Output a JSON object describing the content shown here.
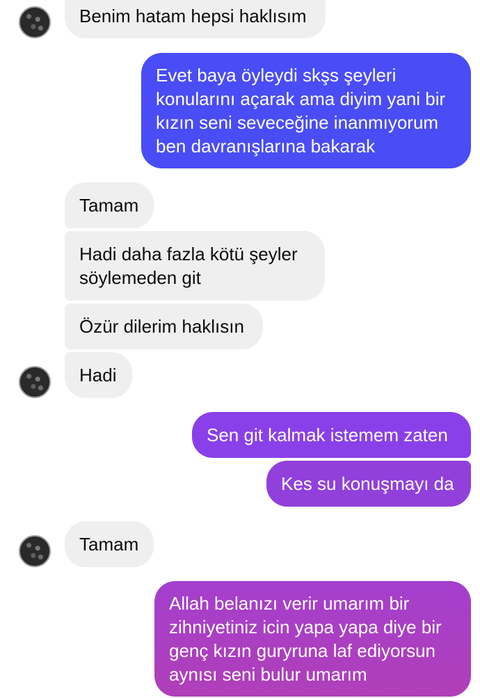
{
  "conversation": {
    "messages": [
      {
        "direction": "incoming",
        "text": "Benim hatam hepsi haklısım"
      },
      {
        "direction": "outgoing",
        "lines": [
          "Evet baya öyleydi skşs şeyleri",
          "konularını açarak ama diyim yani bir",
          "kızın seni seveceğine inanmıyorum",
          "ben davranışlarına bakarak"
        ]
      },
      {
        "direction": "incoming",
        "text": "Tamam"
      },
      {
        "direction": "incoming",
        "lines": [
          "Hadi daha fazla kötü şeyler",
          "söylemeden git"
        ]
      },
      {
        "direction": "incoming",
        "text": "Özür dilerim haklısın"
      },
      {
        "direction": "incoming",
        "text": "Hadi"
      },
      {
        "direction": "outgoing",
        "text": "Sen git kalmak istemem zaten"
      },
      {
        "direction": "outgoing",
        "text": "Kes su konuşmayı da"
      },
      {
        "direction": "incoming",
        "text": "Tamam"
      },
      {
        "direction": "outgoing",
        "lines": [
          "Allah belanızı verir umarım bir",
          "zihniyetiniz icin yapa yapa diye bir",
          "genç kızın guryruna laf ediyorsun",
          "aynısı seni bulur umarım"
        ]
      }
    ]
  },
  "colors": {
    "incoming_bubble": "#efeff0",
    "incoming_text": "#0d0d0d",
    "outgoing_text": "#ffffff",
    "outgoing_gradient_top": "#4b4df6",
    "outgoing_mid": "#8a3fe6",
    "outgoing_gradient_bottom": "#b03fb8"
  },
  "icons": {
    "contact_avatar": "contact-avatar-icon"
  }
}
